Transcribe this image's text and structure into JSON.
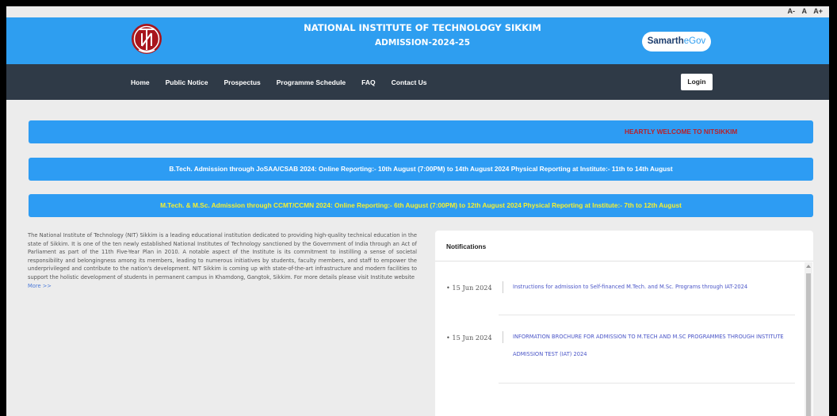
{
  "font_tools": [
    "A-",
    "A",
    "A+"
  ],
  "header": {
    "title": "NATIONAL INSTITUTE OF TECHNOLOGY SIKKIM",
    "subtitle": "ADMISSION-2024-25",
    "brand_main": "Samarth",
    "brand_sub": "eGov",
    "logo_icon": "nit-sikkim-logo-icon",
    "colors": {
      "header_bg": "#2e9ef0",
      "nav_bg": "#2f3a47",
      "logo_red": "#a8151c"
    }
  },
  "nav": {
    "items": [
      "Home",
      "Public Notice",
      "Prospectus",
      "Programme Schedule",
      "FAQ",
      "Contact Us"
    ],
    "login_label": "Login"
  },
  "banners": {
    "welcome": "HEARTLY WELCOME TO NITSIKKIM",
    "btech": "B.Tech. Admission through JoSAA/CSAB 2024: Online Reporting:- 10th August (7:00PM) to 14th August 2024 Physical Reporting at Institute:- 11th to 14th August",
    "mtech": "M.Tech. & M.Sc. Admission through CCMT/CCMN 2024: Online Reporting:- 6th August (7:00PM) to 12th August 2024 Physical Reporting at Institute:- 7th to 12th August"
  },
  "about": {
    "text": "The National Institute of Technology (NIT) Sikkim is a leading educational institution dedicated to providing high-quality technical education in the state of Sikkim. It is one of the ten newly established National Institutes of Technology sanctioned by the Government of India through an Act of Parliament as part of the 11th Five-Year Plan in 2010. A notable aspect of the Institute is its commitment to instilling a sense of societal responsibility and belongingness among its members, leading to numerous initiatives by students, faculty members, and staff to empower the underprivileged and contribute to the nation's development. NIT Sikkim is coming up with state-of-the-art infrastructure and modern facilities to support the holistic development of students in permanent campus in Khamdong, Gangtok, Sikkim. For more details please visit Institute website",
    "more": "More >>"
  },
  "notifications": {
    "title": "Notifications",
    "items": [
      {
        "date": "• 15 Jun 2024",
        "text": "Instructions for admission to Self-financed M.Tech. and M.Sc. Programs through IAT-2024"
      },
      {
        "date": "• 15 Jun 2024",
        "text": "INFORMATION BROCHURE FOR ADMISSION TO M.TECH AND M.SC PROGRAMMES THROUGH INSTITUTE ADMISSION TEST (IAT) 2024"
      }
    ]
  }
}
